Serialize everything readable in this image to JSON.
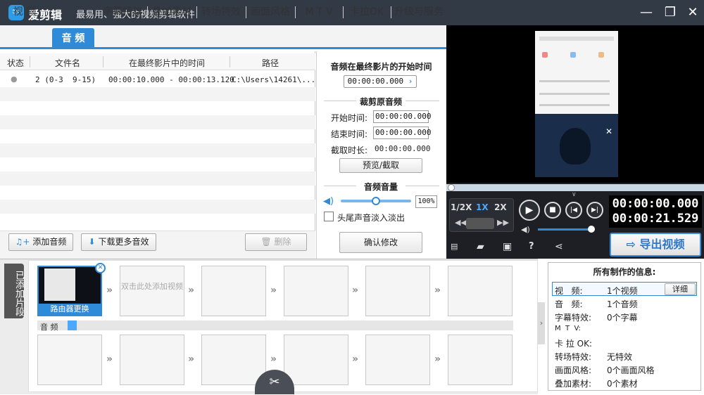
{
  "app": {
    "logo_glyph": "✂",
    "name": "爱剪辑",
    "slogan": "最易用、强大的视频剪辑软件"
  },
  "window_controls": {
    "minimize": "—",
    "maximize": "❐",
    "close": "✕"
  },
  "tabs": [
    {
      "label": "视 频"
    },
    {
      "label": "音 频",
      "active": true
    },
    {
      "label": "字幕特效"
    },
    {
      "label": "叠加素材"
    },
    {
      "label": "转场特效"
    },
    {
      "label": "画面风格"
    },
    {
      "label": "M T V"
    },
    {
      "label": "卡拉OK"
    },
    {
      "label": "升级与服务"
    }
  ],
  "list": {
    "headers": [
      "状态",
      "文件名",
      "在最终影片中的时间",
      "路径"
    ],
    "rows": [
      {
        "status": "●",
        "filename": "2 (0-3  9-15)",
        "time": "00:00:10.000 - 00:00:13.120",
        "path": "C:\\Users\\14261\\..."
      }
    ]
  },
  "settings": {
    "start_label": "音频在最终影片的开始时间",
    "start_value": "00:00:00.000",
    "trim_title": "裁剪原音频",
    "begin_label": "开始时间:",
    "begin_value": "00:00:00.000",
    "end_label": "结束时间:",
    "end_value": "00:00:00.000",
    "duration_label": "截取时长:",
    "duration_value": "00:00:00.000",
    "preview_button": "预览/截取",
    "volume_title": "音频音量",
    "volume_value": "100%",
    "volume_level": 0.5,
    "fade_label": "头尾声音淡入淡出",
    "confirm_button": "确认修改"
  },
  "toolbar": {
    "add_audio": "添加音频",
    "download_more": "下载更多音效",
    "delete": "删除"
  },
  "player": {
    "speeds": [
      "1/2X",
      "1X",
      "2X"
    ],
    "current_speed": "1X",
    "time_current": "00:00:00.000",
    "time_total": "00:00:21.529",
    "export": "导出视频",
    "speed_accent": "#4aa8ff"
  },
  "storyboard": {
    "side_label": "已添加片段",
    "clip_caption": "路由器更换",
    "placeholder": "双击此处添加视频",
    "audio_track_label": "音 频"
  },
  "info": {
    "title": "所有制作的信息:",
    "detail_button": "详细",
    "items": [
      {
        "label": "视   频:",
        "value": "1个视频"
      },
      {
        "label": "音   频:",
        "value": "1个音频"
      },
      {
        "label": "字幕特效:",
        "value": "0个字幕"
      },
      {
        "label": "M  T  V:",
        "value": ""
      },
      {
        "label": "卡 拉 OK:",
        "value": ""
      },
      {
        "label": "转场特效:",
        "value": "无特效"
      },
      {
        "label": "画面风格:",
        "value": "0个画面风格"
      },
      {
        "label": "叠加素材:",
        "value": "0个素材"
      }
    ]
  },
  "colors": {
    "accent": "#2f8ad8",
    "titlebar": "#323a45"
  }
}
